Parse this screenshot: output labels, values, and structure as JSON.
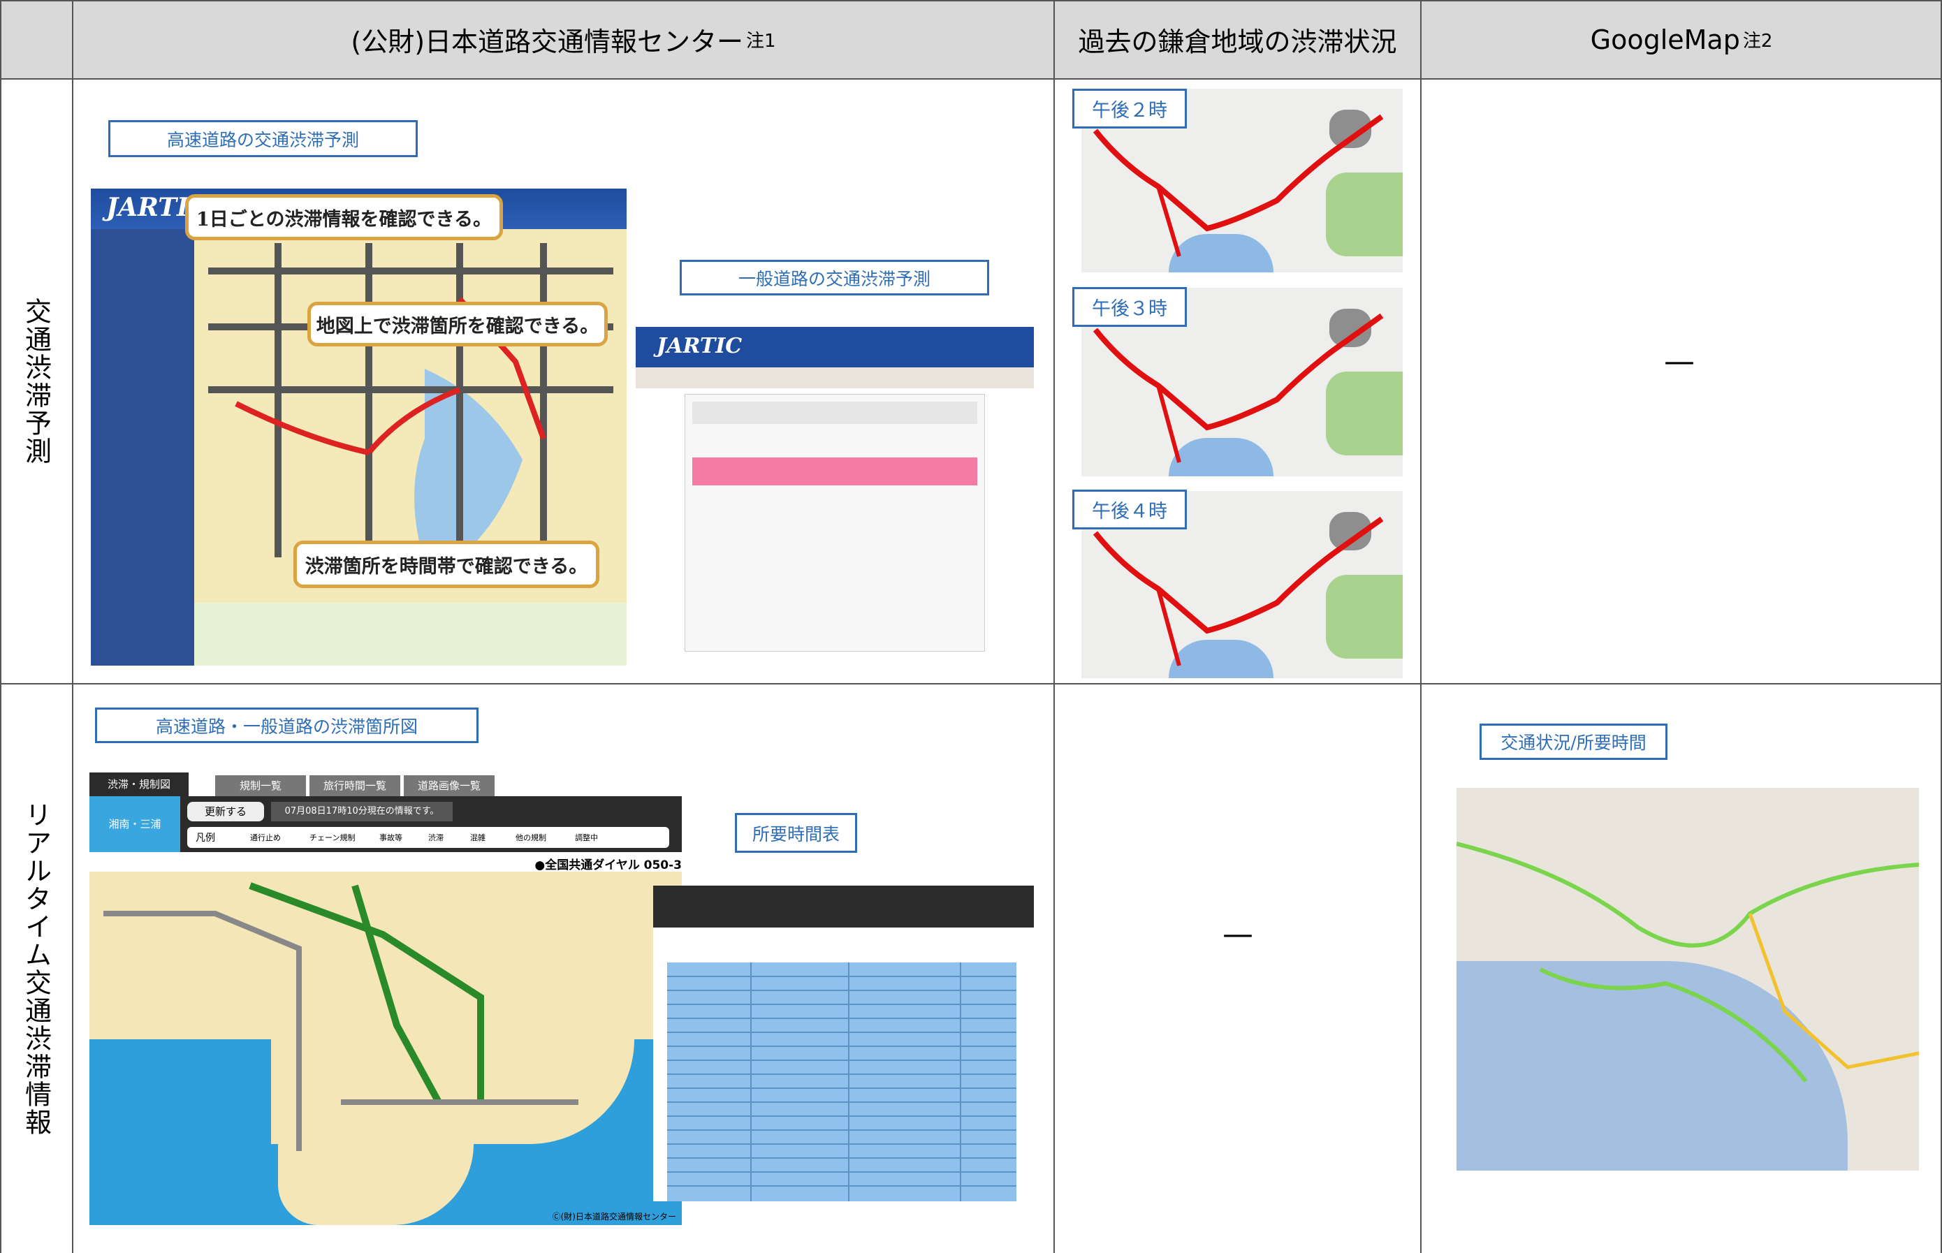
{
  "headers": {
    "col_source": "(公財)日本道路交通情報センター",
    "col_source_note": "注1",
    "col_past": "過去の鎌倉地域の渋滞状況",
    "col_google": "GoogleMap",
    "col_google_note": "注2"
  },
  "rows": {
    "forecast": "交通渋滞予測",
    "realtime": "リアルタイム交通渋滞情報"
  },
  "forecast": {
    "highway_label": "高速道路の交通渋滞予測",
    "general_label": "一般道路の交通渋滞予測",
    "callout_1": "1日ごとの渋滞情報を確認できる。",
    "callout_2": "地図上で渋滞箇所を確認できる。",
    "callout_3": "渋滞箇所を時間帯で確認できる。",
    "jartic_logo": "JARTIC",
    "past_times": [
      "午後２時",
      "午後３時",
      "午後４時"
    ],
    "google_dash": "—"
  },
  "realtime": {
    "map_label": "高速道路・一般道路の渋滞箇所図",
    "time_label": "所要時間表",
    "past_dash": "—",
    "google_label": "交通状況/所要時間",
    "tabs": [
      "渋滞・規制図",
      "規制一覧",
      "旅行時間一覧",
      "道路画像一覧"
    ],
    "area": "湘南・三浦",
    "update_button": "更新する",
    "update_note": "07月08日17時10分現在の情報です。",
    "legend_title": "凡例",
    "legend_items": [
      "通行止め",
      "チェーン規制",
      "事故等",
      "渋滞",
      "混雑",
      "他の規制",
      "調整中"
    ],
    "dial_text": "●全国共通ダイヤル 050-3",
    "copyright": "Ⓒ(財)日本道路交通情報センター"
  },
  "colors": {
    "label_blue": "#2f6eb5",
    "header_gray": "#d9d9d9",
    "callout_gold": "#d9a441"
  }
}
